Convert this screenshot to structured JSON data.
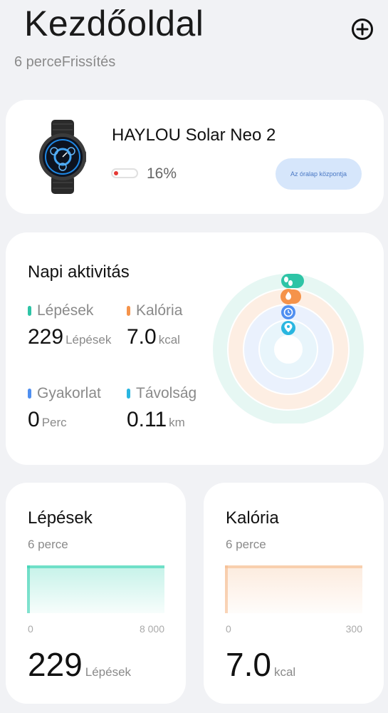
{
  "header": {
    "title": "Kezdőoldal",
    "subtitle": "6 perceFrissítés",
    "add_icon": "plus-circle-icon"
  },
  "device": {
    "name": "HAYLOU Solar Neo 2",
    "battery_percent_text": "16%",
    "battery_level": 0.16,
    "battery_color": "#e53935",
    "center_button_label": "Az óralap központja",
    "image_icon": "smartwatch-icon"
  },
  "activity": {
    "title": "Napi aktivitás",
    "metrics": [
      {
        "label": "Lépések",
        "value": "229",
        "unit": "Lépések",
        "color": "#2ec4a6"
      },
      {
        "label": "Kalória",
        "value": "7.0",
        "unit": "kcal",
        "color": "#f5934a"
      },
      {
        "label": "Gyakorlat",
        "value": "0",
        "unit": "Perc",
        "color": "#4f8ff0"
      },
      {
        "label": "Távolság",
        "value": "0.11",
        "unit": "km",
        "color": "#29b6e0"
      }
    ],
    "ring_icons": [
      "footprint-icon",
      "flame-icon",
      "clock-icon",
      "location-pin-icon"
    ]
  },
  "steps_card": {
    "title": "Lépések",
    "subtitle": "6 perce",
    "axis_min": "0",
    "axis_max": "8 000",
    "value": "229",
    "unit": "Lépések",
    "color": "#33d1b0"
  },
  "calories_card": {
    "title": "Kalória",
    "subtitle": "6 perce",
    "axis_min": "0",
    "axis_max": "300",
    "value": "7.0",
    "unit": "kcal",
    "color": "#f5b98a"
  }
}
